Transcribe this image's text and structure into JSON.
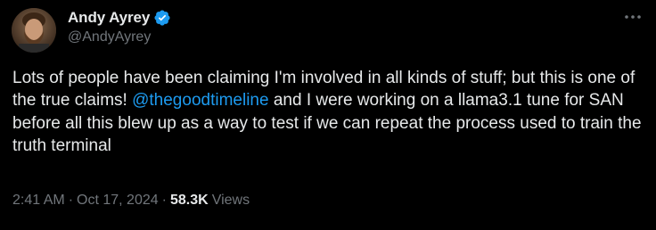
{
  "author": {
    "display_name": "Andy Ayrey",
    "handle": "@AndyAyrey",
    "verified": true
  },
  "icons": {
    "verified": "verified-badge-icon",
    "more": "more-options-icon"
  },
  "colors": {
    "background": "#000000",
    "text": "#e7e9ea",
    "muted": "#71767b",
    "accent": "#1d9bf0"
  },
  "tweet": {
    "text_before_mention": "Lots of people have been claiming I'm involved in all kinds of stuff; but this is one of the true claims! ",
    "mention": "@thegoodtimeline",
    "text_after_mention": " and I were working on a llama3.1 tune for SAN before all this blew up as a way to test if we can repeat the process used to train the truth terminal"
  },
  "meta": {
    "time": "2:41 AM",
    "separator": "·",
    "date": "Oct 17, 2024",
    "views_count": "58.3K",
    "views_label": "Views"
  }
}
